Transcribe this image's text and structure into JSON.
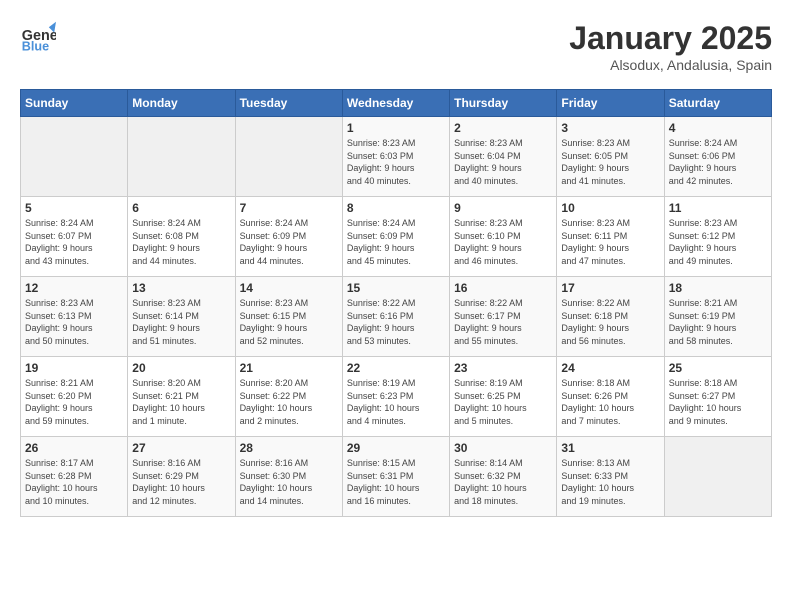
{
  "header": {
    "logo_general": "General",
    "logo_blue": "Blue",
    "title": "January 2025",
    "subtitle": "Alsodux, Andalusia, Spain"
  },
  "weekdays": [
    "Sunday",
    "Monday",
    "Tuesday",
    "Wednesday",
    "Thursday",
    "Friday",
    "Saturday"
  ],
  "weeks": [
    [
      {
        "day": "",
        "info": ""
      },
      {
        "day": "",
        "info": ""
      },
      {
        "day": "",
        "info": ""
      },
      {
        "day": "1",
        "info": "Sunrise: 8:23 AM\nSunset: 6:03 PM\nDaylight: 9 hours\nand 40 minutes."
      },
      {
        "day": "2",
        "info": "Sunrise: 8:23 AM\nSunset: 6:04 PM\nDaylight: 9 hours\nand 40 minutes."
      },
      {
        "day": "3",
        "info": "Sunrise: 8:23 AM\nSunset: 6:05 PM\nDaylight: 9 hours\nand 41 minutes."
      },
      {
        "day": "4",
        "info": "Sunrise: 8:24 AM\nSunset: 6:06 PM\nDaylight: 9 hours\nand 42 minutes."
      }
    ],
    [
      {
        "day": "5",
        "info": "Sunrise: 8:24 AM\nSunset: 6:07 PM\nDaylight: 9 hours\nand 43 minutes."
      },
      {
        "day": "6",
        "info": "Sunrise: 8:24 AM\nSunset: 6:08 PM\nDaylight: 9 hours\nand 44 minutes."
      },
      {
        "day": "7",
        "info": "Sunrise: 8:24 AM\nSunset: 6:09 PM\nDaylight: 9 hours\nand 44 minutes."
      },
      {
        "day": "8",
        "info": "Sunrise: 8:24 AM\nSunset: 6:09 PM\nDaylight: 9 hours\nand 45 minutes."
      },
      {
        "day": "9",
        "info": "Sunrise: 8:23 AM\nSunset: 6:10 PM\nDaylight: 9 hours\nand 46 minutes."
      },
      {
        "day": "10",
        "info": "Sunrise: 8:23 AM\nSunset: 6:11 PM\nDaylight: 9 hours\nand 47 minutes."
      },
      {
        "day": "11",
        "info": "Sunrise: 8:23 AM\nSunset: 6:12 PM\nDaylight: 9 hours\nand 49 minutes."
      }
    ],
    [
      {
        "day": "12",
        "info": "Sunrise: 8:23 AM\nSunset: 6:13 PM\nDaylight: 9 hours\nand 50 minutes."
      },
      {
        "day": "13",
        "info": "Sunrise: 8:23 AM\nSunset: 6:14 PM\nDaylight: 9 hours\nand 51 minutes."
      },
      {
        "day": "14",
        "info": "Sunrise: 8:23 AM\nSunset: 6:15 PM\nDaylight: 9 hours\nand 52 minutes."
      },
      {
        "day": "15",
        "info": "Sunrise: 8:22 AM\nSunset: 6:16 PM\nDaylight: 9 hours\nand 53 minutes."
      },
      {
        "day": "16",
        "info": "Sunrise: 8:22 AM\nSunset: 6:17 PM\nDaylight: 9 hours\nand 55 minutes."
      },
      {
        "day": "17",
        "info": "Sunrise: 8:22 AM\nSunset: 6:18 PM\nDaylight: 9 hours\nand 56 minutes."
      },
      {
        "day": "18",
        "info": "Sunrise: 8:21 AM\nSunset: 6:19 PM\nDaylight: 9 hours\nand 58 minutes."
      }
    ],
    [
      {
        "day": "19",
        "info": "Sunrise: 8:21 AM\nSunset: 6:20 PM\nDaylight: 9 hours\nand 59 minutes."
      },
      {
        "day": "20",
        "info": "Sunrise: 8:20 AM\nSunset: 6:21 PM\nDaylight: 10 hours\nand 1 minute."
      },
      {
        "day": "21",
        "info": "Sunrise: 8:20 AM\nSunset: 6:22 PM\nDaylight: 10 hours\nand 2 minutes."
      },
      {
        "day": "22",
        "info": "Sunrise: 8:19 AM\nSunset: 6:23 PM\nDaylight: 10 hours\nand 4 minutes."
      },
      {
        "day": "23",
        "info": "Sunrise: 8:19 AM\nSunset: 6:25 PM\nDaylight: 10 hours\nand 5 minutes."
      },
      {
        "day": "24",
        "info": "Sunrise: 8:18 AM\nSunset: 6:26 PM\nDaylight: 10 hours\nand 7 minutes."
      },
      {
        "day": "25",
        "info": "Sunrise: 8:18 AM\nSunset: 6:27 PM\nDaylight: 10 hours\nand 9 minutes."
      }
    ],
    [
      {
        "day": "26",
        "info": "Sunrise: 8:17 AM\nSunset: 6:28 PM\nDaylight: 10 hours\nand 10 minutes."
      },
      {
        "day": "27",
        "info": "Sunrise: 8:16 AM\nSunset: 6:29 PM\nDaylight: 10 hours\nand 12 minutes."
      },
      {
        "day": "28",
        "info": "Sunrise: 8:16 AM\nSunset: 6:30 PM\nDaylight: 10 hours\nand 14 minutes."
      },
      {
        "day": "29",
        "info": "Sunrise: 8:15 AM\nSunset: 6:31 PM\nDaylight: 10 hours\nand 16 minutes."
      },
      {
        "day": "30",
        "info": "Sunrise: 8:14 AM\nSunset: 6:32 PM\nDaylight: 10 hours\nand 18 minutes."
      },
      {
        "day": "31",
        "info": "Sunrise: 8:13 AM\nSunset: 6:33 PM\nDaylight: 10 hours\nand 19 minutes."
      },
      {
        "day": "",
        "info": ""
      }
    ]
  ]
}
